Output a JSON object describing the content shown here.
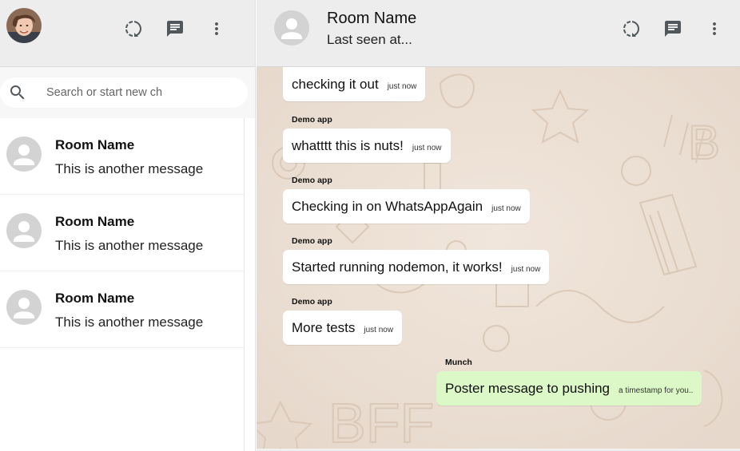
{
  "sidebar": {
    "header": {
      "icons": [
        "status-icon",
        "new-chat-icon",
        "more-vert-icon"
      ]
    },
    "search": {
      "placeholder": "Search or start new ch"
    },
    "chats": [
      {
        "name": "Room Name",
        "last_message": "This is another message"
      },
      {
        "name": "Room Name",
        "last_message": "This is another message"
      },
      {
        "name": "Room Name",
        "last_message": "This is another message"
      }
    ]
  },
  "chat": {
    "header": {
      "title": "Room Name",
      "subtitle": "Last seen at...",
      "icons": [
        "status-icon",
        "new-chat-icon",
        "more-vert-icon"
      ]
    },
    "messages": [
      {
        "sender": "",
        "text": "checking it out",
        "time": "just now",
        "sent": false
      },
      {
        "sender": "Demo app",
        "text": "whatttt this is nuts!",
        "time": "just now",
        "sent": false
      },
      {
        "sender": "Demo app",
        "text": "Checking in on WhatsAppAgain",
        "time": "just now",
        "sent": false
      },
      {
        "sender": "Demo app",
        "text": "Started running nodemon, it works!",
        "time": "just now",
        "sent": false
      },
      {
        "sender": "Demo app",
        "text": "More tests",
        "time": "just now",
        "sent": false
      },
      {
        "sender": "Munch",
        "text": "Poster message to pushing",
        "time": "a timestamp for you..",
        "sent": true
      }
    ]
  },
  "colors": {
    "header_bg": "#ededed",
    "chat_bg": "#ebe0d5",
    "sent_bubble": "#dcf8c6",
    "received_bubble": "#ffffff",
    "icon": "#51585c"
  }
}
